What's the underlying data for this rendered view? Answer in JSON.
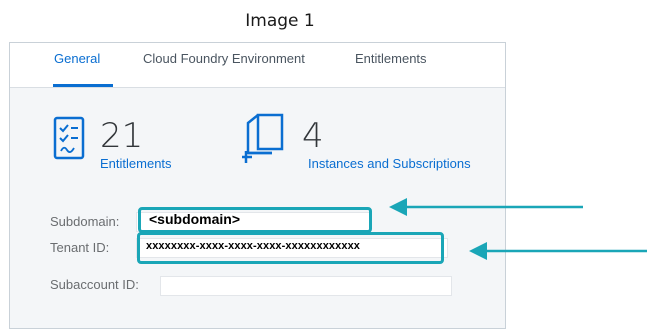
{
  "caption": "Image 1",
  "tabs": [
    {
      "label": "General",
      "active": true
    },
    {
      "label": "Cloud Foundry Environment",
      "active": false
    },
    {
      "label": "Entitlements",
      "active": false
    }
  ],
  "tiles": [
    {
      "count": "21",
      "link": "Entitlements",
      "icon": "checklist-icon"
    },
    {
      "count": "4",
      "link": "Instances and Subscriptions",
      "icon": "add-instance-icon"
    }
  ],
  "fields": {
    "subdomain": {
      "label": "Subdomain:",
      "value": "<subdomain>"
    },
    "tenant_id": {
      "label": "Tenant ID:",
      "value": "xxxxxxxx-xxxx-xxxx-xxxx-xxxxxxxxxxxx"
    },
    "subaccount_id": {
      "label": "Subaccount ID:",
      "value": ""
    }
  },
  "colors": {
    "accent": "#0a6ed1",
    "highlight": "#1aa6b7",
    "panel_bg": "#f4f6f8"
  }
}
